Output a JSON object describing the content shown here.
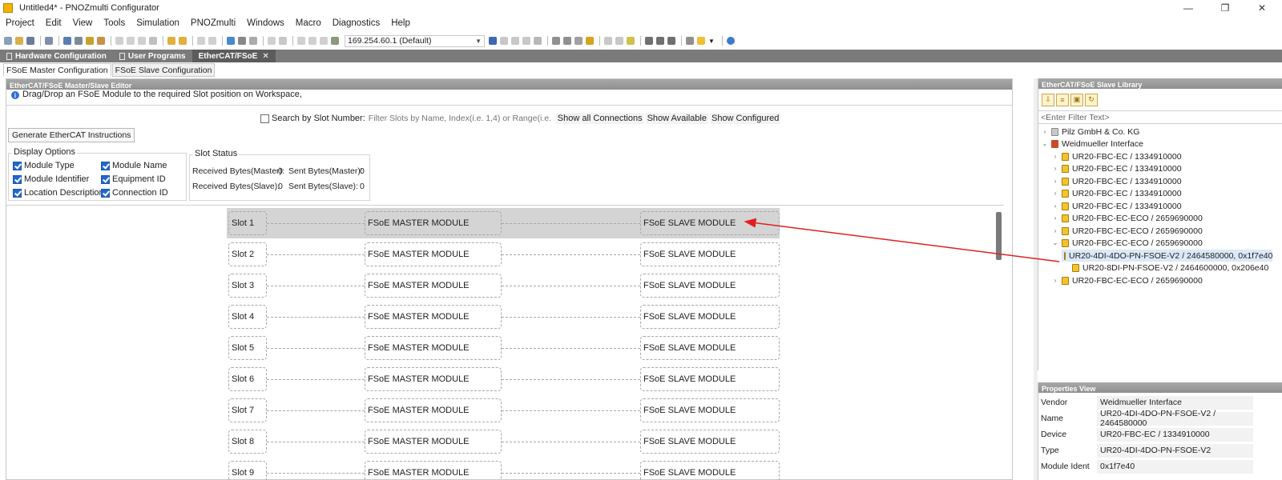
{
  "window": {
    "title": "Untitled4* - PNOZmulti Configurator",
    "min": "—",
    "max": "❐",
    "close": "✕"
  },
  "menu": [
    "Project",
    "Edit",
    "View",
    "Tools",
    "Simulation",
    "PNOZmulti",
    "Windows",
    "Macro",
    "Diagnostics",
    "Help"
  ],
  "toolbar": {
    "ip_value": "169.254.60.1 (Default)"
  },
  "editor_tabs": [
    {
      "label": "Hardware Configuration",
      "active": false
    },
    {
      "label": "User Programs",
      "active": false
    },
    {
      "label": "EtherCAT/FSoE",
      "active": true,
      "close": "✕"
    }
  ],
  "sub_tabs": [
    "FSoE Master Configuration",
    "FSoE Slave Configuration"
  ],
  "editor": {
    "header": "EtherCAT/FSoE Master/Slave Editor",
    "hint": "Drag/Drop an FSoE Module to the required Slot position on Workspace,",
    "search_label": "Search by Slot Number:",
    "filter_placeholder": "Filter Slots by Name, Index(i.e. 1,4) or Range(i.e. 1-4)",
    "btn_show_all": "Show all Connections",
    "btn_show_available": "Show Available",
    "btn_show_configured": "Show Configured",
    "btn_generate": "Generate EtherCAT Instructions",
    "display_options": {
      "title": "Display Options",
      "items": [
        {
          "label": "Module Type",
          "checked": true
        },
        {
          "label": "Module Identifier",
          "checked": true
        },
        {
          "label": "Location Description",
          "checked": true
        },
        {
          "label": "Module Name",
          "checked": true
        },
        {
          "label": "Equipment ID",
          "checked": true
        },
        {
          "label": "Connection ID",
          "checked": true
        }
      ]
    },
    "slot_status": {
      "title": "Slot Status",
      "recv_master_label": "Received Bytes(Master):",
      "recv_master": "0",
      "sent_master_label": "Sent Bytes(Master):",
      "sent_master": "0",
      "recv_slave_label": "Received Bytes(Slave):",
      "recv_slave": "0",
      "sent_slave_label": "Sent Bytes(Slave):",
      "sent_slave": "0"
    }
  },
  "slots": [
    {
      "slot": "Slot 1",
      "master": "FSoE MASTER MODULE",
      "slave": "FSoE SLAVE MODULE",
      "selected": true
    },
    {
      "slot": "Slot 2",
      "master": "FSoE MASTER MODULE",
      "slave": "FSoE SLAVE MODULE"
    },
    {
      "slot": "Slot 3",
      "master": "FSoE MASTER MODULE",
      "slave": "FSoE SLAVE MODULE"
    },
    {
      "slot": "Slot 4",
      "master": "FSoE MASTER MODULE",
      "slave": "FSoE SLAVE MODULE"
    },
    {
      "slot": "Slot 5",
      "master": "FSoE MASTER MODULE",
      "slave": "FSoE SLAVE MODULE"
    },
    {
      "slot": "Slot 6",
      "master": "FSoE MASTER MODULE",
      "slave": "FSoE SLAVE MODULE"
    },
    {
      "slot": "Slot 7",
      "master": "FSoE MASTER MODULE",
      "slave": "FSoE SLAVE MODULE"
    },
    {
      "slot": "Slot 8",
      "master": "FSoE MASTER MODULE",
      "slave": "FSoE SLAVE MODULE"
    },
    {
      "slot": "Slot 9",
      "master": "FSoE MASTER MODULE",
      "slave": "FSoE SLAVE MODULE"
    }
  ],
  "library": {
    "header": "EtherCAT/FSoE Slave Library",
    "filter_placeholder": "<Enter Filter Text>",
    "tree": [
      {
        "label": "Pilz GmbH & Co. KG",
        "level": 0,
        "twisty": "›",
        "icon": "pilz"
      },
      {
        "label": "Weidmueller Interface",
        "level": 0,
        "twisty": "⌄",
        "icon": "weid"
      },
      {
        "label": "UR20-FBC-EC / 1334910000",
        "level": 1,
        "twisty": "›",
        "icon": "dev"
      },
      {
        "label": "UR20-FBC-EC / 1334910000",
        "level": 1,
        "twisty": "›",
        "icon": "dev"
      },
      {
        "label": "UR20-FBC-EC / 1334910000",
        "level": 1,
        "twisty": "›",
        "icon": "dev"
      },
      {
        "label": "UR20-FBC-EC / 1334910000",
        "level": 1,
        "twisty": "›",
        "icon": "dev"
      },
      {
        "label": "UR20-FBC-EC / 1334910000",
        "level": 1,
        "twisty": "›",
        "icon": "dev"
      },
      {
        "label": "UR20-FBC-EC-ECO / 2659690000",
        "level": 1,
        "twisty": "›",
        "icon": "dev"
      },
      {
        "label": "UR20-FBC-EC-ECO / 2659690000",
        "level": 1,
        "twisty": "›",
        "icon": "dev"
      },
      {
        "label": "UR20-FBC-EC-ECO / 2659690000",
        "level": 1,
        "twisty": "⌄",
        "icon": "dev"
      },
      {
        "label": "UR20-4DI-4DO-PN-FSOE-V2 / 2464580000, 0x1f7e40",
        "level": 2,
        "twisty": "",
        "icon": "dev",
        "highlight": true
      },
      {
        "label": "UR20-8DI-PN-FSOE-V2 / 2464600000, 0x206e40",
        "level": 2,
        "twisty": "",
        "icon": "dev"
      },
      {
        "label": "UR20-FBC-EC-ECO / 2659690000",
        "level": 1,
        "twisty": "›",
        "icon": "dev"
      }
    ]
  },
  "properties": {
    "header": "Properties View",
    "rows": [
      {
        "key": "Vendor",
        "value": "Weidmueller Interface"
      },
      {
        "key": "Name",
        "value": "UR20-4DI-4DO-PN-FSOE-V2 / 2464580000"
      },
      {
        "key": "Device",
        "value": "UR20-FBC-EC / 1334910000"
      },
      {
        "key": "Type",
        "value": "UR20-4DI-4DO-PN-FSOE-V2"
      },
      {
        "key": "Module Ident",
        "value": "0x1f7e40"
      }
    ]
  },
  "colors": {
    "arrow": "#e02020",
    "tab_bar": "#7a7a7a",
    "selected_row": "#d4d4d4",
    "tree_highlight": "#dbe8f8"
  }
}
